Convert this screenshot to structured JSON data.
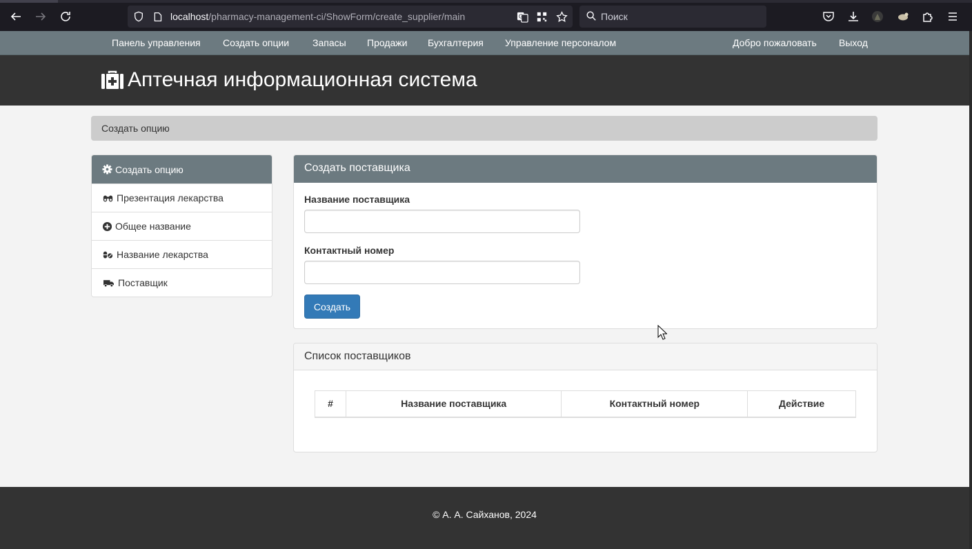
{
  "browser": {
    "url_host": "localhost",
    "url_path": "/pharmacy-management-ci/ShowForm/create_supplier/main",
    "search_placeholder": "Поиск"
  },
  "nav": {
    "dashboard": "Панель управления",
    "create_options": "Создать опции",
    "stock": "Запасы",
    "sales": "Продажи",
    "accounting": "Бухгалтерия",
    "hr": "Управление персоналом",
    "welcome": "Добро пожаловать",
    "logout": "Выход"
  },
  "header": {
    "title": "Аптечная информационная система"
  },
  "breadcrumb": {
    "current": "Создать опцию"
  },
  "sidebar": {
    "heading": "Создать опцию",
    "items": [
      {
        "label": "Презентация лекарства",
        "icon": "binoculars-icon"
      },
      {
        "label": "Общее название",
        "icon": "plus-circle-icon"
      },
      {
        "label": "Название лекарства",
        "icon": "pills-icon"
      },
      {
        "label": "Поставщик",
        "icon": "truck-icon"
      }
    ]
  },
  "create_panel": {
    "heading": "Создать поставщика",
    "name_label": "Название поставщика",
    "name_value": "",
    "phone_label": "Контактный номер",
    "phone_value": "",
    "submit_label": "Создать"
  },
  "list_panel": {
    "heading": "Список поставщиков",
    "columns": [
      "#",
      "Название поставщика",
      "Контактный номер",
      "Действие"
    ],
    "rows": []
  },
  "footer": {
    "copyright": "© А. А. Сайханов, 2024"
  },
  "colors": {
    "nav_bg": "#6c7a80",
    "header_bg": "#333333",
    "primary_button": "#337ab7"
  }
}
